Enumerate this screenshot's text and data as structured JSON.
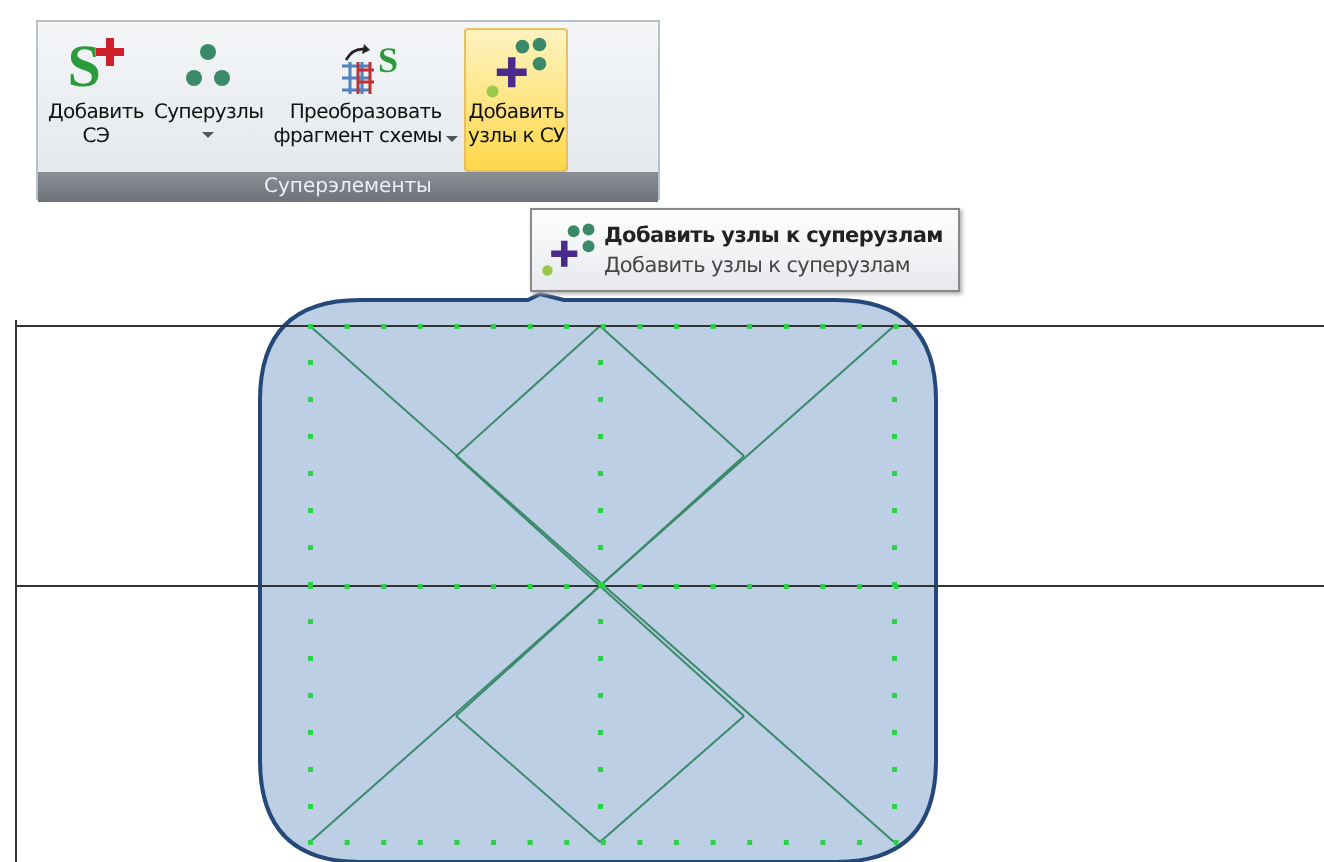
{
  "ribbon": {
    "buttons": [
      {
        "kind": "add-se",
        "glyph": "S",
        "lines": [
          "Добавить",
          "СЭ"
        ],
        "dropdown": false,
        "selected": false
      },
      {
        "kind": "supernodes",
        "lines": [
          "Суперузлы"
        ],
        "dropdown": true,
        "selected": false
      },
      {
        "kind": "convert",
        "glyph": "S",
        "lines": [
          "Преобразовать",
          "фрагмент схемы"
        ],
        "dropdown": true,
        "selected": false
      },
      {
        "kind": "add-nodes",
        "lines": [
          "Добавить",
          "узлы к СУ"
        ],
        "dropdown": false,
        "selected": true
      }
    ],
    "group_label": "Суперэлементы"
  },
  "tooltip": {
    "title": "Добавить узлы к суперузлам",
    "description": "Добавить узлы к суперузлам"
  }
}
